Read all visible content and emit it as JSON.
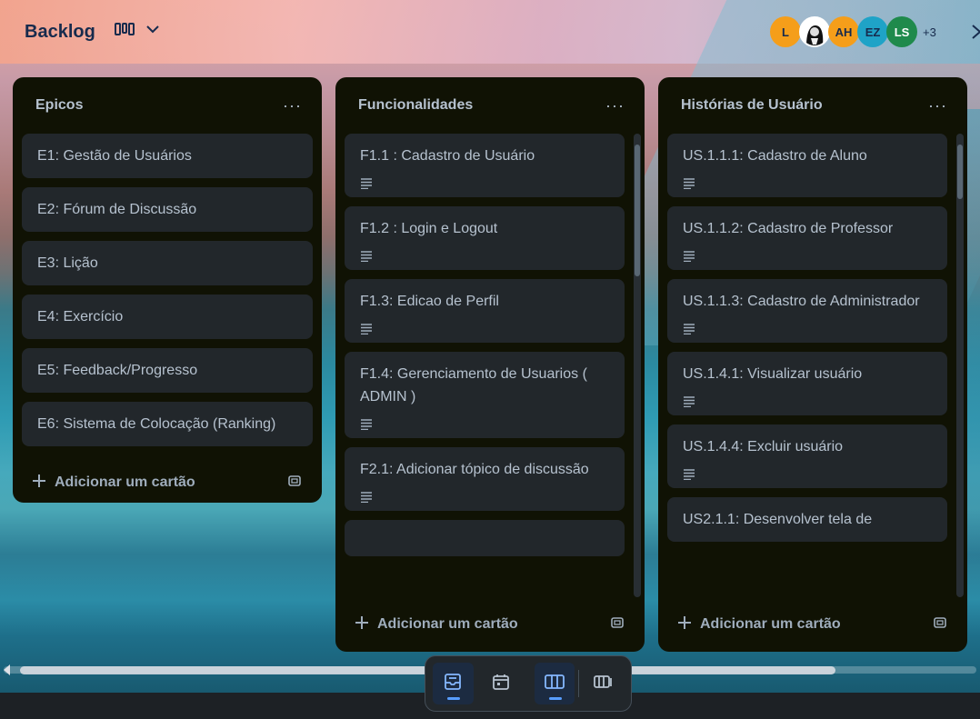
{
  "header": {
    "board_title": "Backlog",
    "members": [
      {
        "initials": "L",
        "color": "#f59e1a"
      },
      {
        "initials": "",
        "color": "#ffffff",
        "photo": true
      },
      {
        "initials": "AH",
        "color": "#f59e1a"
      },
      {
        "initials": "EZ",
        "color": "#1fa3c7"
      },
      {
        "initials": "LS",
        "color": "#1f8a4c"
      }
    ],
    "more_members": "+3"
  },
  "lists": [
    {
      "title": "Epicos",
      "cards": [
        {
          "title": "E1: Gestão de Usuários"
        },
        {
          "title": "E2: Fórum de Discussão"
        },
        {
          "title": "E3: Lição"
        },
        {
          "title": "E4: Exercício"
        },
        {
          "title": "E5: Feedback/Progresso"
        },
        {
          "title": "E6: Sistema de Colocação (Ranking)"
        }
      ],
      "add_label": "Adicionar um cartão"
    },
    {
      "title": "Funcionalidades",
      "cards": [
        {
          "title": "F1.1 : Cadastro de Usuário"
        },
        {
          "title": "F1.2 : Login e Logout"
        },
        {
          "title": "F1.3: Edicao de Perfil"
        },
        {
          "title": "F1.4: Gerenciamento de Usuarios ( ADMIN )"
        },
        {
          "title": "F2.1: Adicionar tópico de discussão"
        }
      ],
      "add_label": "Adicionar um cartão"
    },
    {
      "title": "Histórias de Usuário",
      "cards": [
        {
          "title": "US.1.1.1: Cadastro de Aluno"
        },
        {
          "title": "US.1.1.2: Cadastro de Professor"
        },
        {
          "title": "US.1.1.3: Cadastro de Administrador"
        },
        {
          "title": "US.1.4.1: Visualizar usuário"
        },
        {
          "title": "US.1.4.4: Excluir usuário"
        },
        {
          "title": "US2.1.1: Desenvolver tela de"
        }
      ],
      "add_label": "Adicionar um cartão"
    }
  ],
  "view_switcher": {
    "items": [
      "inbox-icon",
      "calendar-icon",
      "board-icon",
      "switch-boards-icon"
    ],
    "active": "board-icon"
  },
  "colors": {
    "list_bg": "#101204",
    "card_bg": "#22272b",
    "text": "#b6c2cf",
    "accent": "#579dff"
  }
}
